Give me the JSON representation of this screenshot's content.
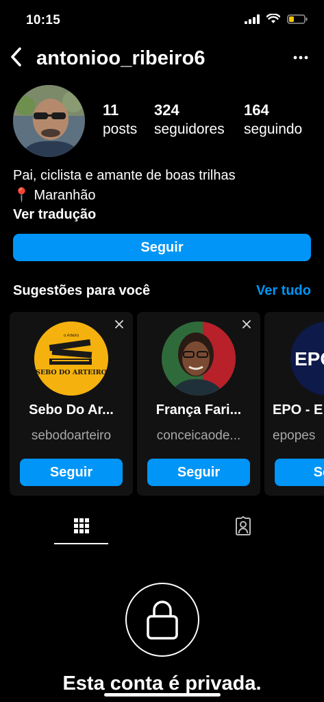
{
  "status_bar": {
    "time": "10:15"
  },
  "header": {
    "username": "antonioo_ribeiro6"
  },
  "stats": [
    {
      "value": "11",
      "label": "posts"
    },
    {
      "value": "324",
      "label": "seguidores"
    },
    {
      "value": "164",
      "label": "seguindo"
    }
  ],
  "bio": {
    "line1": "Pai, ciclista e amante de boas trilhas",
    "location_emoji": "📍",
    "location": "Maranhão",
    "translate_label": "Ver tradução"
  },
  "follow_button": "Seguir",
  "suggestions": {
    "title": "Sugestões para você",
    "see_all": "Ver tudo",
    "cards": [
      {
        "name": "Sebo Do Ar...",
        "handle": "sebodoarteiro",
        "button": "Seguir",
        "logo_text": "SEBO DO ARTEIRO",
        "logo_tag": "o Arteiro"
      },
      {
        "name": "França Fari...",
        "handle": "conceicaode...",
        "button": "Seguir"
      },
      {
        "name": "EPO - E",
        "handle": "epopes",
        "button": "Seg",
        "logo_text": "EPO"
      }
    ]
  },
  "private_message": "Esta conta é privada.",
  "colors": {
    "accent": "#0095f6",
    "background": "#000000",
    "card": "#121212",
    "muted": "#a8a8a8"
  }
}
